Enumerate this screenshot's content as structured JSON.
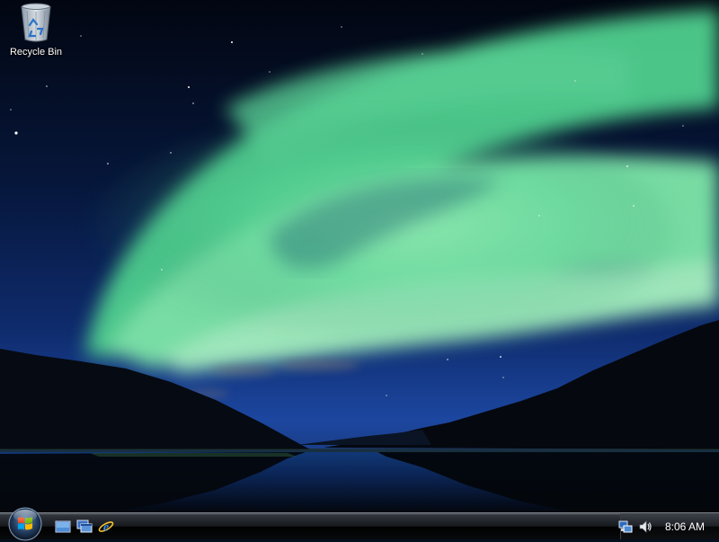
{
  "desktop": {
    "icons": [
      {
        "label": "Recycle Bin",
        "icon": "recycle-bin-icon"
      }
    ]
  },
  "taskbar": {
    "start_button": {
      "icon": "windows-start-orb-icon"
    },
    "quick_launch": [
      {
        "icon": "show-desktop-icon"
      },
      {
        "icon": "switch-windows-icon"
      },
      {
        "icon": "internet-explorer-icon"
      }
    ],
    "tray": {
      "icons": [
        {
          "icon": "network-icon"
        },
        {
          "icon": "volume-icon"
        }
      ],
      "clock": "8:06 AM"
    }
  },
  "colors": {
    "aurora": "#6fe0a0",
    "sky_top": "#020816",
    "sky_horizon": "#1a3f8f",
    "taskbar": "#0b0c0f"
  }
}
